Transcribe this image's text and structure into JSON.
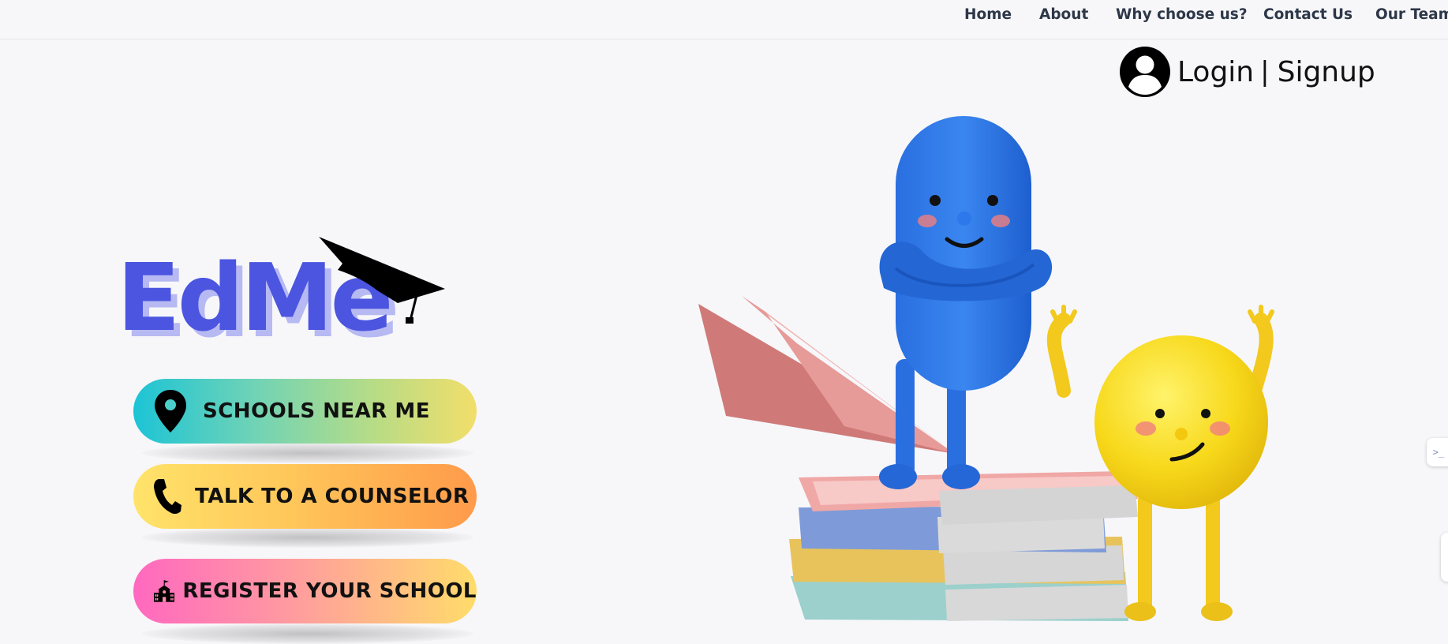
{
  "nav": {
    "items": [
      {
        "label": "Home"
      },
      {
        "label": "About"
      },
      {
        "label": "Why choose us?"
      },
      {
        "label": "Contact Us"
      },
      {
        "label": "Our Team"
      }
    ]
  },
  "auth": {
    "login_label": "Login",
    "separator": "|",
    "signup_label": "Signup",
    "icon": "user-avatar-icon"
  },
  "logo": {
    "text": "EdMe",
    "icon": "graduation-cap-icon",
    "color": "#4b55e0",
    "shadow_color": "#b7b9f2"
  },
  "actions": [
    {
      "label": "SCHOOLS NEAR ME",
      "icon": "location-pin-icon"
    },
    {
      "label": "TALK TO A COUNSELOR",
      "icon": "phone-icon"
    },
    {
      "label": "REGISTER YOUR SCHOOL",
      "icon": "school-building-icon"
    }
  ],
  "side_tab": {
    "text": ">_"
  },
  "colors": {
    "background": "#f7f7fa",
    "nav_text": "#2d3748",
    "blue_character": "#2f7ae5",
    "yellow_character": "#f5d216"
  }
}
